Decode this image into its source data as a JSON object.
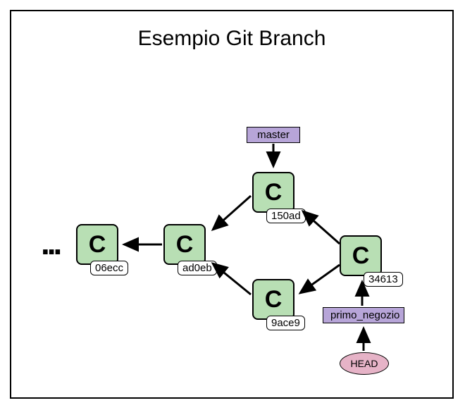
{
  "title": "Esempio Git Branch",
  "commits": {
    "c1": {
      "letter": "C",
      "hash": "06ecc"
    },
    "c2": {
      "letter": "C",
      "hash": "ad0eb"
    },
    "c3": {
      "letter": "C",
      "hash": "150ad"
    },
    "c4": {
      "letter": "C",
      "hash": "9ace9"
    },
    "c5": {
      "letter": "C",
      "hash": "34613"
    }
  },
  "branches": {
    "master": "master",
    "primo_negozio": "primo_negozio"
  },
  "head": "HEAD",
  "ellipsis": "...",
  "colors": {
    "commit_bg": "#b8dfb4",
    "branch_bg": "#b7a5d8",
    "head_bg": "#e6b3c7"
  }
}
